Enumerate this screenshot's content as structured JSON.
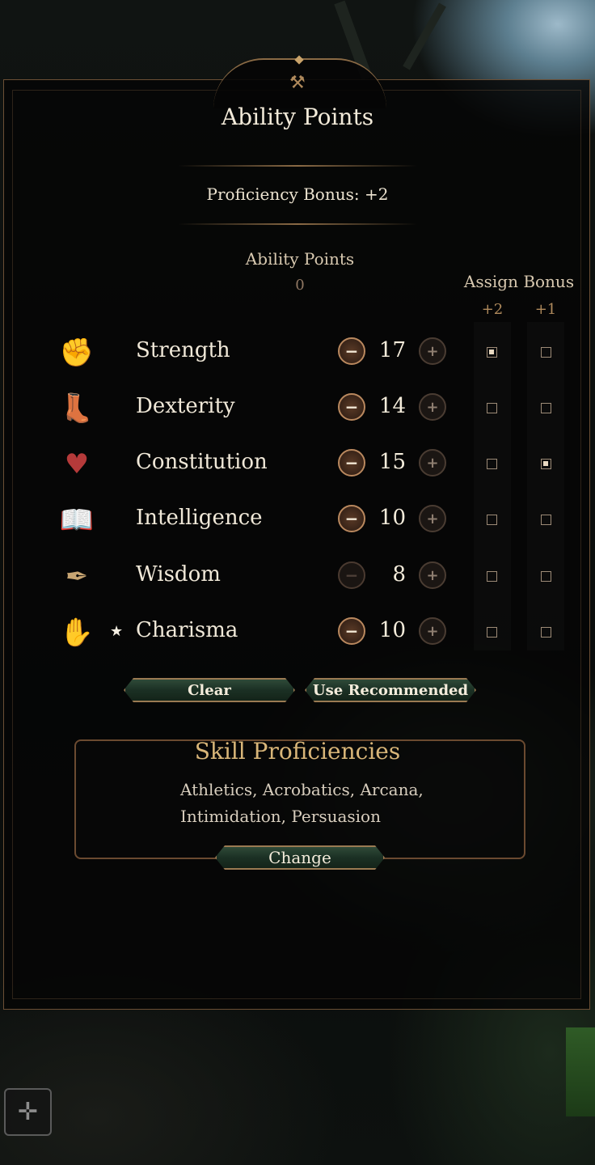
{
  "title": "Ability Points",
  "proficiency_bonus": "Proficiency Bonus: +2",
  "ability_points": {
    "label": "Ability Points",
    "value": "0"
  },
  "assign_bonus": {
    "label": "Assign Bonus",
    "col_plus2": "+2",
    "col_plus1": "+1"
  },
  "abilities": [
    {
      "name": "Strength",
      "icon": "gauntlet-icon",
      "glyph": "✊",
      "value": "17",
      "minus_enabled": true,
      "bonus2": true,
      "bonus1": false,
      "starred": false
    },
    {
      "name": "Dexterity",
      "icon": "boot-icon",
      "glyph": "👢",
      "value": "14",
      "minus_enabled": true,
      "bonus2": false,
      "bonus1": false,
      "starred": false
    },
    {
      "name": "Constitution",
      "icon": "shield-heart-icon",
      "glyph": "♥",
      "value": "15",
      "minus_enabled": true,
      "bonus2": false,
      "bonus1": true,
      "starred": false
    },
    {
      "name": "Intelligence",
      "icon": "book-icon",
      "glyph": "📖",
      "value": "10",
      "minus_enabled": true,
      "bonus2": false,
      "bonus1": false,
      "starred": false
    },
    {
      "name": "Wisdom",
      "icon": "scroll-quill-icon",
      "glyph": "✒",
      "value": "8",
      "minus_enabled": false,
      "bonus2": false,
      "bonus1": false,
      "starred": false
    },
    {
      "name": "Charisma",
      "icon": "handshake-icon",
      "glyph": "✋",
      "value": "10",
      "minus_enabled": true,
      "bonus2": false,
      "bonus1": false,
      "starred": true
    }
  ],
  "star_glyph": "★",
  "minus_glyph": "−",
  "plus_glyph": "+",
  "buttons": {
    "clear": "Clear",
    "use_recommended": "Use Recommended",
    "change": "Change"
  },
  "skills": {
    "title": "Skill Proficiencies",
    "line1": "Athletics, Acrobatics, Arcana,",
    "line2": "Intimidation, Persuasion"
  },
  "crest_glyph": "⚒",
  "corner_glyph": "✛"
}
